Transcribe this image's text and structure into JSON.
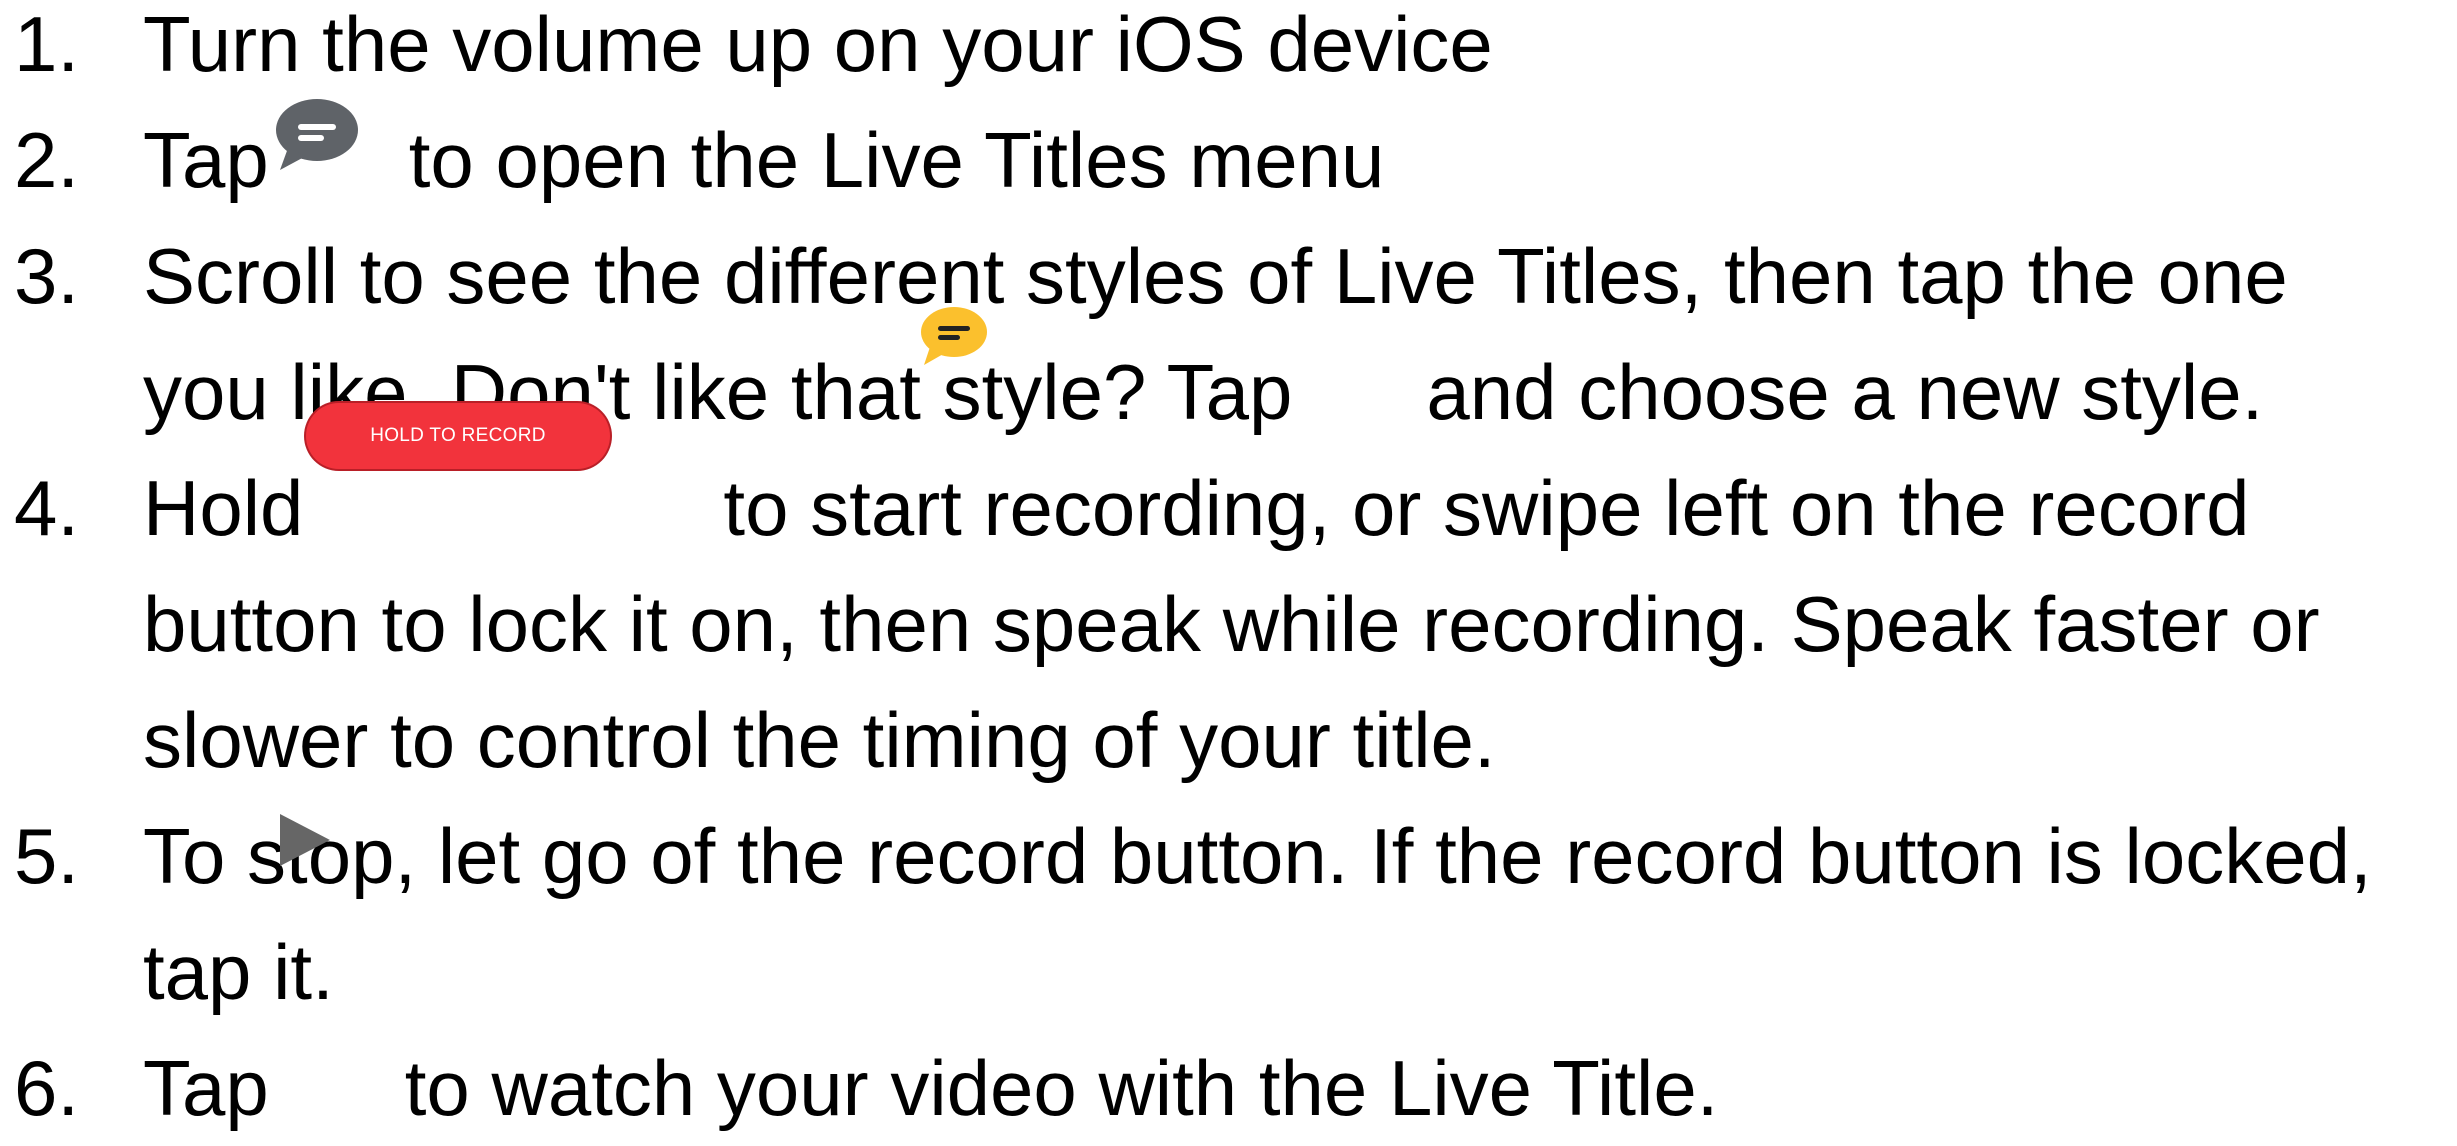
{
  "steps": [
    {
      "number": "1.",
      "lines": [
        "Turn the volume up on your iOS device"
      ]
    },
    {
      "number": "2.",
      "before_icon": "Tap",
      "after_icon": "to open the Live Titles menu",
      "icon": "speech-bubble-icon"
    },
    {
      "number": "3.",
      "line1": "Scroll to see the different styles of Live Titles, then tap the one",
      "line2_before_icon": "you like. Don't like that style? Tap",
      "line2_after_icon": "and choose a new style.",
      "icon": "yellow-speech-bubble-icon"
    },
    {
      "number": "4.",
      "line1_before_button": "Hold",
      "line1_after_button": "to start recording, or swipe left on the record",
      "line2": "button to lock it on, then speak while recording. Speak faster or",
      "line3": "slower to control the timing of your title.",
      "button_label": "HOLD TO RECORD"
    },
    {
      "number": "5.",
      "line1": "To stop, let go of the record button. If the record button is locked,",
      "line2": "tap it."
    },
    {
      "number": "6.",
      "before_icon": "Tap",
      "after_icon": "to watch your video with the Live Title.",
      "icon": "play-icon"
    }
  ],
  "colors": {
    "record_button": "#f2333c",
    "bubble_gray": "#5f6368",
    "bubble_yellow": "#fbc02d",
    "play_gray": "#666666"
  }
}
